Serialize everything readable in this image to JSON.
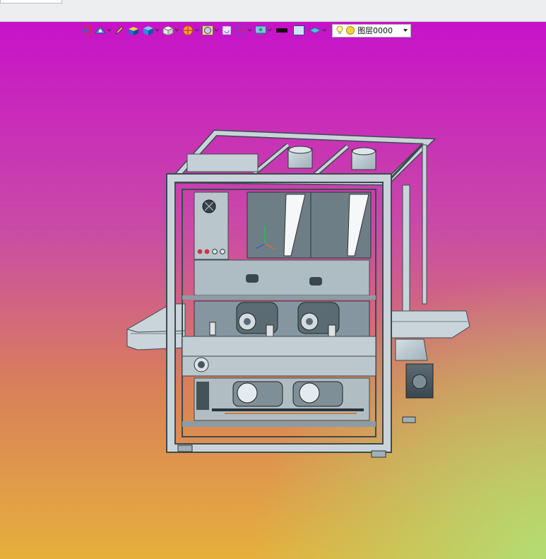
{
  "layer": {
    "value": "图层0000"
  },
  "toolbar": {
    "icons": [
      "sketch-exit-icon",
      "view-orient-icon",
      "pen-icon",
      "solid-block-icon",
      "cube-icon",
      "box-view-icon",
      "section-icon",
      "magnifier-icon",
      "repaint-icon",
      "frame-icon",
      "display-icon",
      "color-black-icon",
      "color-light-icon",
      "shade-icon",
      "bulb-icon",
      "layer-state-icon"
    ]
  },
  "colors": {
    "accent_toolbar": "#1f6fd1",
    "model_fill": "#b7c6cc",
    "model_dark": "#4a5a62"
  }
}
